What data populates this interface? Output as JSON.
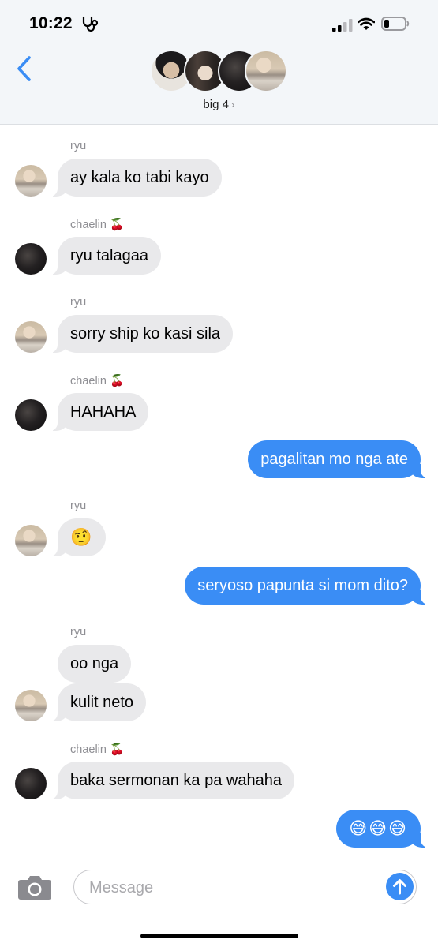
{
  "status_bar": {
    "time": "10:22",
    "icons": [
      "stethoscope-icon",
      "cellular-signal-icon",
      "wifi-icon",
      "battery-icon"
    ]
  },
  "header": {
    "group_name": "big 4",
    "chevron": "›",
    "back_icon": "chevron-left-icon"
  },
  "colors": {
    "accent": "#3a8df5",
    "incoming_bubble": "#e9e9eb",
    "header_bg": "#f3f6f9",
    "sender_label": "#8e8e93"
  },
  "messages": [
    {
      "sender": "ryu",
      "text": "ay kala ko tabi kayo",
      "direction": "incoming"
    },
    {
      "sender": "chaelin 🍒",
      "text": "ryu talagaa",
      "direction": "incoming"
    },
    {
      "sender": "ryu",
      "text": "sorry ship ko kasi sila",
      "direction": "incoming"
    },
    {
      "sender": "chaelin 🍒",
      "text": "HAHAHA",
      "direction": "incoming"
    },
    {
      "text": "pagalitan mo nga ate",
      "direction": "outgoing"
    },
    {
      "sender": "ryu",
      "text": "🤨",
      "direction": "incoming"
    },
    {
      "text": "seryoso papunta si mom dito?",
      "direction": "outgoing"
    },
    {
      "sender": "ryu",
      "text": "oo nga",
      "direction": "incoming"
    },
    {
      "text": "kulit neto",
      "direction": "incoming"
    },
    {
      "sender": "chaelin 🍒",
      "text": "baka sermonan ka pa wahaha",
      "direction": "incoming"
    },
    {
      "text": "😅😅😅",
      "direction": "outgoing"
    }
  ],
  "composer": {
    "placeholder": "Message",
    "value": "",
    "camera_icon": "camera-icon",
    "send_icon": "arrow-up-icon"
  }
}
